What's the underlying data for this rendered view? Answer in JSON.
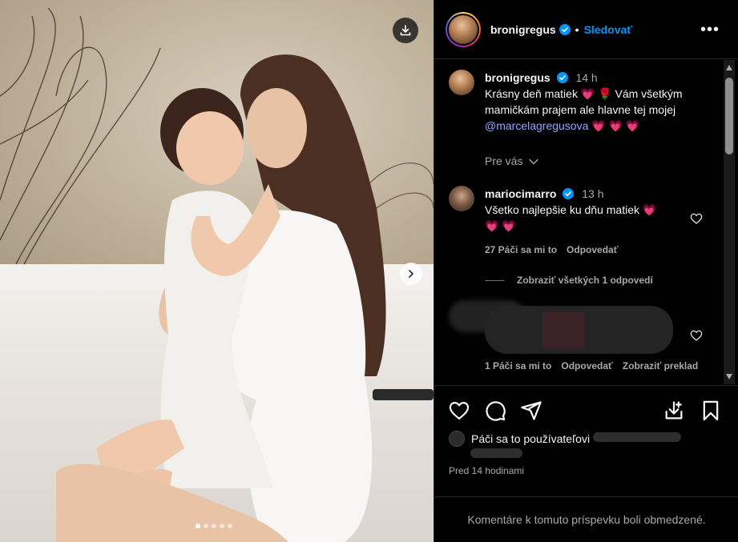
{
  "post": {
    "username": "bronigregus",
    "follow_label": "Sledovať",
    "more_label": "•••",
    "carousel": {
      "count": 5,
      "active_index": 0
    }
  },
  "caption": {
    "username": "bronigregus",
    "time": "14 h",
    "text_1": "Krásny deň matiek",
    "text_2": "Vám všetkým mamičkám prajem ale hlavne tej mojej",
    "mention": "@marcelagregusova",
    "hearts": "💗 💗 💗",
    "for_you": "Pre vás"
  },
  "comments": [
    {
      "username": "mariocimarro",
      "time": "13 h",
      "text": "Všetko najlepšie ku dňu matiek",
      "hearts_inline": "💗",
      "hearts_line2": "💗 💗",
      "likes": "27 Páči sa mi to",
      "reply": "Odpovedať",
      "view_replies": "Zobraziť všetkých 1 odpovedí"
    },
    {
      "likes": "1 Páči sa mi to",
      "reply": "Odpovedať",
      "translate": "Zobraziť preklad"
    }
  ],
  "liked_by": "Páči sa to používateľovi",
  "time_ago": "Pred 14 hodinami",
  "restricted": "Komentáre k tomuto príspevku boli obmedzené.",
  "colors": {
    "accent": "#0095f6",
    "mention": "#93a5ff",
    "heart": "#ff3040"
  }
}
